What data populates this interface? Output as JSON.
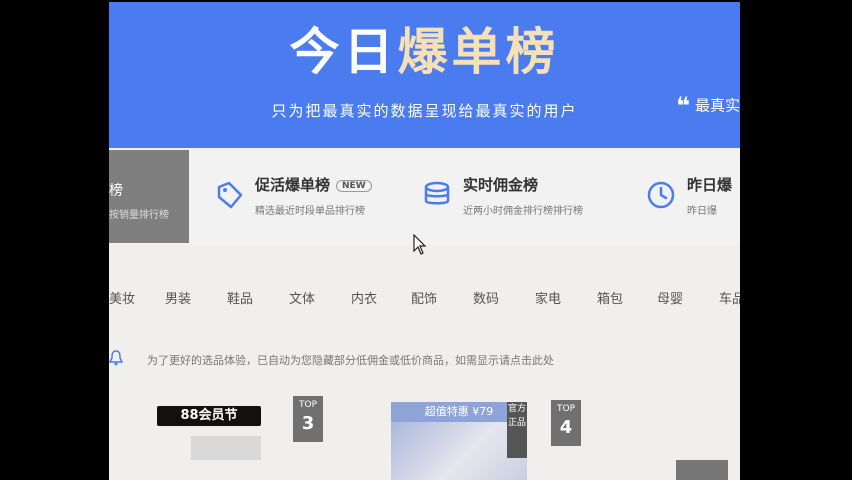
{
  "header": {
    "title_part1": "今日",
    "title_part2": "爆单榜",
    "subtitle": "只为把最真实的数据呈现给最真实的用户",
    "quote_mark": "❝",
    "quote_text": "最真实"
  },
  "cards": [
    {
      "label": "榜",
      "desc": "按销量排行榜",
      "active": true
    },
    {
      "label": "促活爆单榜",
      "badge": "NEW",
      "desc": "精选最近时段单品排行榜"
    },
    {
      "label": "实时佣金榜",
      "desc": "近两小时佣金排行榜排行榜"
    },
    {
      "label": "昨日爆",
      "desc": "昨日爆"
    }
  ],
  "categories": [
    "美妆",
    "男装",
    "鞋品",
    "文体",
    "内衣",
    "配饰",
    "数码",
    "家电",
    "箱包",
    "母婴",
    "车品"
  ],
  "notice": {
    "text": "为了更好的选品体验，已自动为您隐藏部分低佣金或低价商品，如需显示请点击此处",
    "link": "点击此处"
  },
  "products": {
    "banner": "88会员节",
    "ranks": [
      {
        "top": "TOP",
        "num": "3"
      },
      {
        "top": "TOP",
        "num": "4"
      }
    ],
    "image_label": "超值特惠 ¥79",
    "vertical_badge": "官方正品"
  },
  "colors": {
    "brand_blue": "#4a7cf0",
    "title_accent": "#f7dfb6"
  }
}
